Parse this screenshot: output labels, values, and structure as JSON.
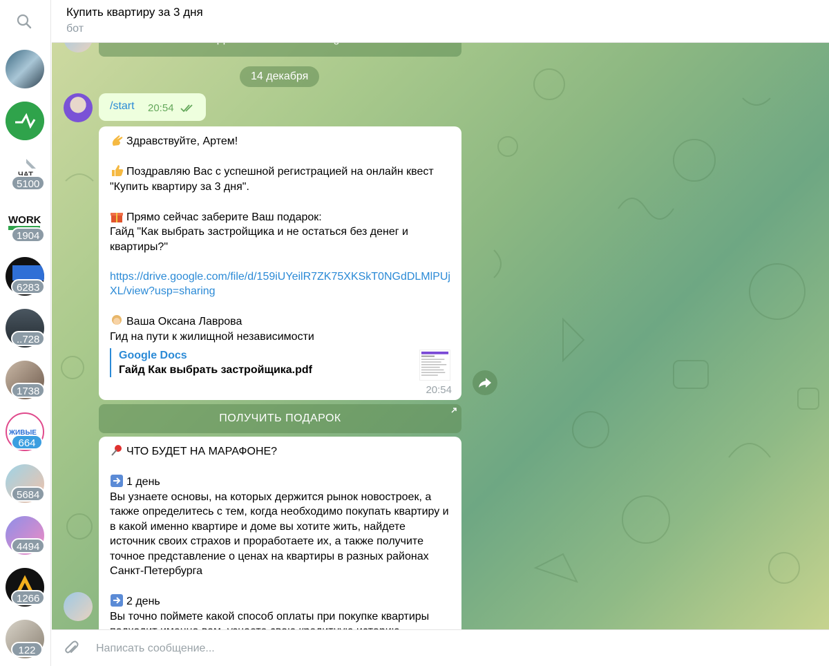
{
  "header": {
    "title": "Купить квартиру за 3 дня",
    "subtitle": "бот"
  },
  "sidebar": {
    "chats": [
      {
        "name": "chat-1",
        "badge": ""
      },
      {
        "name": "chat-2",
        "badge": ""
      },
      {
        "name": "chat-3",
        "badge": "5100",
        "logo_text": "ЧАТ"
      },
      {
        "name": "chat-4",
        "badge": "1904",
        "logo_text": "WORK"
      },
      {
        "name": "chat-5",
        "badge": "6283"
      },
      {
        "name": "chat-6",
        "badge": "..728"
      },
      {
        "name": "chat-7",
        "badge": "1738"
      },
      {
        "name": "chat-8",
        "badge": "664",
        "logo_text": "ЖИВЫЕ"
      },
      {
        "name": "chat-9",
        "badge": "5684"
      },
      {
        "name": "chat-10",
        "badge": "4494"
      },
      {
        "name": "chat-11",
        "badge": "1266"
      },
      {
        "name": "chat-12",
        "badge": "122"
      }
    ]
  },
  "chat": {
    "top_button_label": "ПОДПИСАТЬСЯ на Instagram",
    "date_separator": "14 декабря",
    "start_message": {
      "text": "/start",
      "time": "20:54"
    },
    "message1": {
      "greeting": "Здравствуйте,  Артем!",
      "congrats": "Поздравляю Вас с успешной регистрацией на онлайн квест \"Купить квартиру за 3 дня\".",
      "gift_intro": "Прямо сейчас заберите Ваш подарок:",
      "gift_guide": "Гайд \"Как выбрать застройщика и не остаться без денег и квартиры?\"",
      "link": "https://drive.google.com/file/d/159iUYeilR7ZK75XKSkT0NGdDLMlPUjXL/view?usp=sharing",
      "signature_name": "Ваша Оксана Лаврова",
      "signature_role": "Гид на пути к жилищной независимости",
      "preview_site": "Google Docs",
      "preview_title": "Гайд Как выбрать застройщика.pdf",
      "time": "20:54"
    },
    "gift_button_label": "ПОЛУЧИТЬ ПОДАРОК",
    "message2": {
      "heading": "ЧТО БУДЕТ НА МАРАФОНЕ?",
      "day1_title": "1 день",
      "day1_text": "Вы узнаете основы, на которых держится рынок новостроек, а также определитесь с тем, когда необходимо покупать квартиру и в какой именно квартире и доме вы хотите жить, найдете источник своих страхов и проработаете их, а также получите точное представление о ценах на квартиры в разных районах Санкт-Петербурга",
      "day2_title": "2 день",
      "day2_text": "Вы точно поймете какой способ оплаты при покупке квартиры подходит именно вам, узнаете свою кредитную историю"
    }
  },
  "composer": {
    "placeholder": "Написать сообщение..."
  },
  "colors": {
    "accent": "#2b8ad6",
    "out_bubble": "#eeffde",
    "badge": "#8b9aa5"
  }
}
